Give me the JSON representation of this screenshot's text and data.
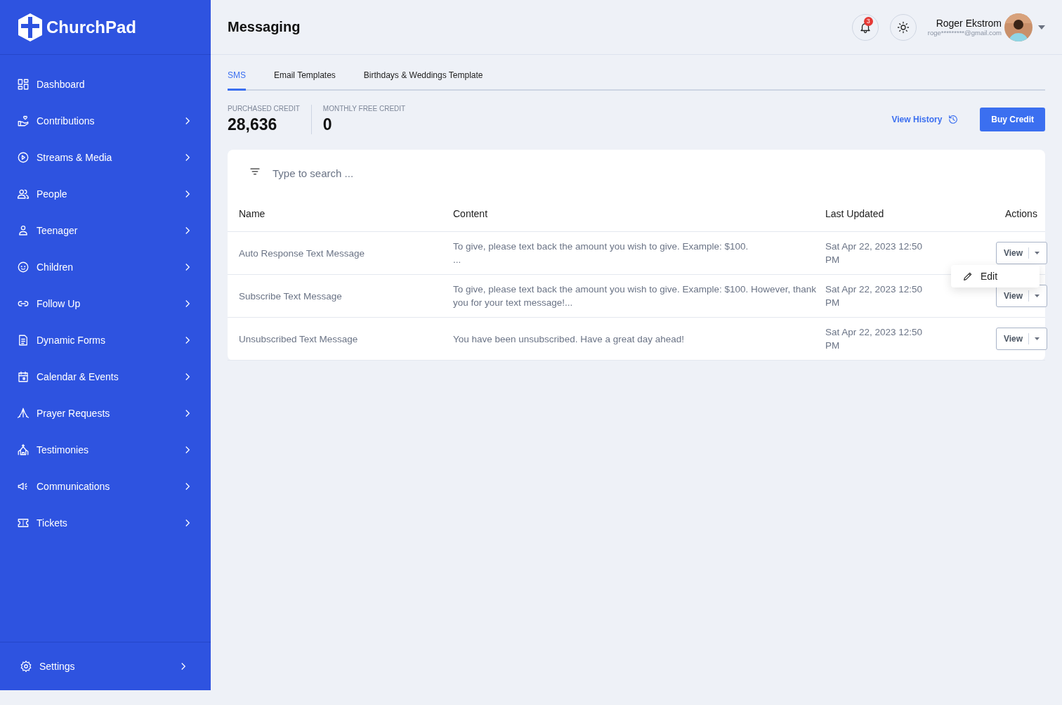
{
  "sidebar": {
    "logo": "ChurchPad",
    "items": [
      {
        "label": "Dashboard",
        "has_submenu": false
      },
      {
        "label": "Contributions",
        "has_submenu": true
      },
      {
        "label": "Streams & Media",
        "has_submenu": true
      },
      {
        "label": "People",
        "has_submenu": true
      },
      {
        "label": "Teenager",
        "has_submenu": true
      },
      {
        "label": "Children",
        "has_submenu": true
      },
      {
        "label": "Follow Up",
        "has_submenu": true
      },
      {
        "label": "Dynamic Forms",
        "has_submenu": true
      },
      {
        "label": "Calendar & Events",
        "has_submenu": true
      },
      {
        "label": "Prayer Requests",
        "has_submenu": true
      },
      {
        "label": "Testimonies",
        "has_submenu": true
      },
      {
        "label": "Communications",
        "has_submenu": true
      },
      {
        "label": "Tickets",
        "has_submenu": true
      }
    ],
    "footer": {
      "label": "Settings",
      "has_submenu": true
    }
  },
  "header": {
    "title": "Messaging",
    "notification_count": "3",
    "user": {
      "name": "Roger Ekstrom",
      "email": "roge*********@gmail.com"
    }
  },
  "tabs": [
    {
      "label": "SMS",
      "selected": true
    },
    {
      "label": "Email Templates",
      "selected": false
    },
    {
      "label": "Birthdays & Weddings Template",
      "selected": false
    }
  ],
  "credits": [
    {
      "label": "PURCHASED CREDIT",
      "value": "28,636"
    },
    {
      "label": "MONTHLY FREE CREDIT",
      "value": "0"
    }
  ],
  "actions": {
    "history": "View History",
    "buy": "Buy Credit"
  },
  "search": {
    "placeholder": "Type to search ..."
  },
  "table": {
    "columns": [
      "Name",
      "Content",
      "Last Updated",
      "Actions"
    ],
    "rows": [
      {
        "name": "Auto Response Text Message",
        "content": "To give, please text back the amount you wish to give. Example: $100.\n...",
        "updated": "Sat Apr 22, 2023 12:50 PM",
        "action": "View"
      },
      {
        "name": "Subscribe Text Message",
        "content": "To give, please text back the amount you wish to give. Example: $100.  However, thank you for your text message!...",
        "updated": "Sat Apr 22, 2023 12:50 PM",
        "action": "View"
      },
      {
        "name": "Unsubscribed Text Message",
        "content": "You have been unsubscribed. Have a great day ahead!",
        "updated": "Sat Apr 22, 2023 12:50 PM",
        "action": "View"
      }
    ]
  },
  "row_menu": {
    "items": [
      "Edit"
    ]
  }
}
